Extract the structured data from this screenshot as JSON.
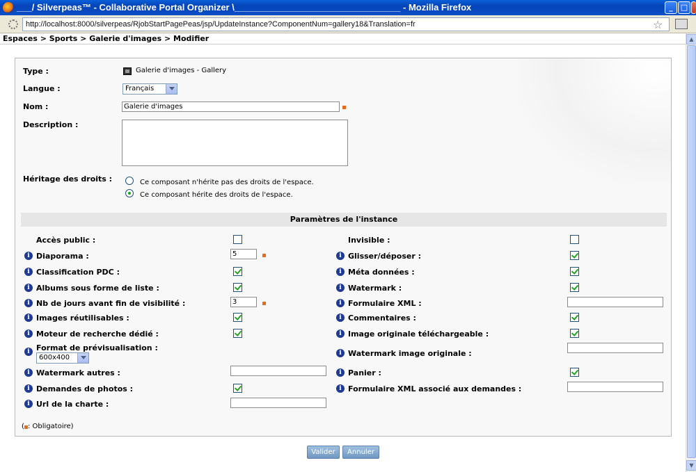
{
  "window": {
    "title": "___/ Silverpeas™ - Collaborative Portal Organizer \\_________________________________ - Mozilla Firefox",
    "url": "http://localhost:8000/silverpeas/RjobStartPagePeas/jsp/UpdateInstance?ComponentNum=gallery18&Translation=fr",
    "buttons": {
      "minimize": "_",
      "maximize": "□",
      "close": "X"
    }
  },
  "breadcrumb": "Espaces > Sports > Galerie d'images > Modifier",
  "form": {
    "type_label": "Type :",
    "type_value": "Galerie d'images - Gallery",
    "langue_label": "Langue :",
    "langue_value": "Français",
    "nom_label": "Nom :",
    "nom_value": "Galerie d'images",
    "description_label": "Description :",
    "description_value": "",
    "heritage_label": "Héritage des droits :",
    "heritage_options": [
      {
        "label": "Ce composant n'hérite pas des droits de l'espace.",
        "selected": false
      },
      {
        "label": "Ce composant hérite des droits de l'espace.",
        "selected": true
      }
    ]
  },
  "params": {
    "header": "Paramètres de l'instance",
    "left": [
      {
        "label": "Accès public :",
        "info": false,
        "kind": "checkbox",
        "checked": false
      },
      {
        "label": "Diaporama :",
        "info": true,
        "kind": "text",
        "value": "5",
        "required": true
      },
      {
        "label": "Classification PDC :",
        "info": true,
        "kind": "checkbox",
        "checked": true
      },
      {
        "label": "Albums sous forme de liste :",
        "info": true,
        "kind": "checkbox",
        "checked": true
      },
      {
        "label": "Nb de jours avant fin de visibilité :",
        "info": true,
        "kind": "text",
        "value": "3",
        "required": true
      },
      {
        "label": "Images réutilisables :",
        "info": true,
        "kind": "checkbox",
        "checked": true
      },
      {
        "label": "Moteur de recherche dédié :",
        "info": true,
        "kind": "checkbox",
        "checked": true
      },
      {
        "label": "Format de prévisualisation :",
        "info": true,
        "kind": "select",
        "value": "600x400"
      },
      {
        "label": "Watermark autres :",
        "info": true,
        "kind": "text",
        "value": ""
      },
      {
        "label": "Demandes de photos :",
        "info": true,
        "kind": "checkbox",
        "checked": true
      },
      {
        "label": "Url de la charte :",
        "info": true,
        "kind": "text",
        "value": ""
      }
    ],
    "right": [
      {
        "label": "Invisible :",
        "info": false,
        "kind": "checkbox",
        "checked": false
      },
      {
        "label": "Glisser/déposer :",
        "info": true,
        "kind": "checkbox",
        "checked": true
      },
      {
        "label": "Méta données :",
        "info": true,
        "kind": "checkbox",
        "checked": true
      },
      {
        "label": "Watermark :",
        "info": true,
        "kind": "checkbox",
        "checked": true
      },
      {
        "label": "Formulaire XML :",
        "info": true,
        "kind": "text",
        "value": ""
      },
      {
        "label": "Commentaires :",
        "info": true,
        "kind": "checkbox",
        "checked": true
      },
      {
        "label": "Image originale téléchargeable :",
        "info": true,
        "kind": "checkbox",
        "checked": true
      },
      {
        "label": "Watermark image originale :",
        "info": true,
        "kind": "text",
        "value": ""
      },
      {
        "label": "Panier :",
        "info": true,
        "kind": "checkbox",
        "checked": true
      },
      {
        "label": "Formulaire XML associé aux demandes :",
        "info": true,
        "kind": "text",
        "value": ""
      }
    ]
  },
  "legend": {
    "open": "(",
    "text": " : Obligatoire)"
  },
  "buttons": {
    "validate": "Valider",
    "cancel": "Annuler"
  },
  "colors": {
    "required": "#e86a1c",
    "info": "#1f3a93",
    "check": "#21a121"
  }
}
